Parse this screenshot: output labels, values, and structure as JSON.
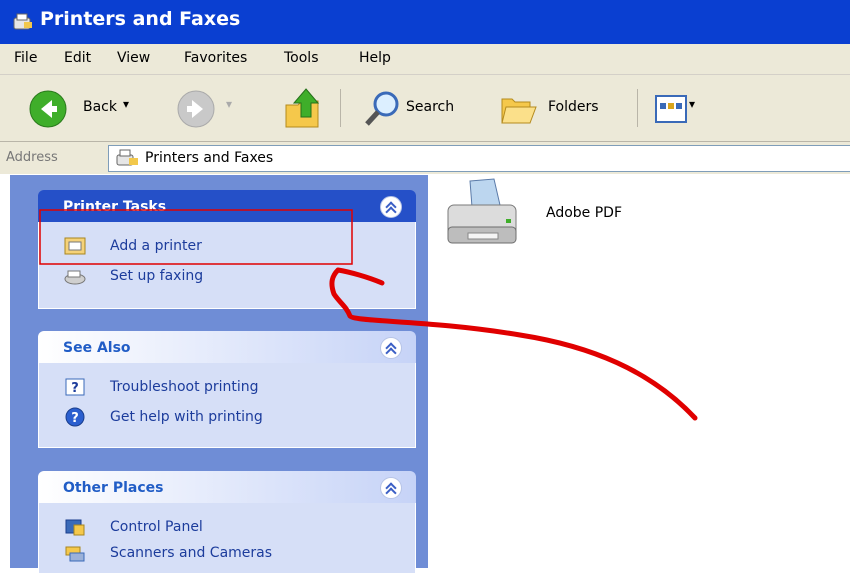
{
  "window": {
    "title": "Printers and Faxes"
  },
  "menu": [
    "File",
    "Edit",
    "View",
    "Favorites",
    "Tools",
    "Help"
  ],
  "toolbar": {
    "back": "Back",
    "search": "Search",
    "folders": "Folders"
  },
  "address": {
    "label": "Address",
    "value": "Printers and Faxes"
  },
  "panels": {
    "printer_tasks": {
      "title": "Printer Tasks",
      "items": [
        "Add a printer",
        "Set up faxing"
      ]
    },
    "see_also": {
      "title": "See Also",
      "items": [
        "Troubleshoot printing",
        "Get help with printing"
      ]
    },
    "other_places": {
      "title": "Other Places",
      "items": [
        "Control Panel",
        "Scanners and Cameras"
      ]
    }
  },
  "printers": [
    {
      "name": "Adobe PDF"
    }
  ],
  "colors": {
    "title_bar": "#0a3fd1",
    "task_pane": "#6f8dd6",
    "annotation": "#e00000"
  }
}
